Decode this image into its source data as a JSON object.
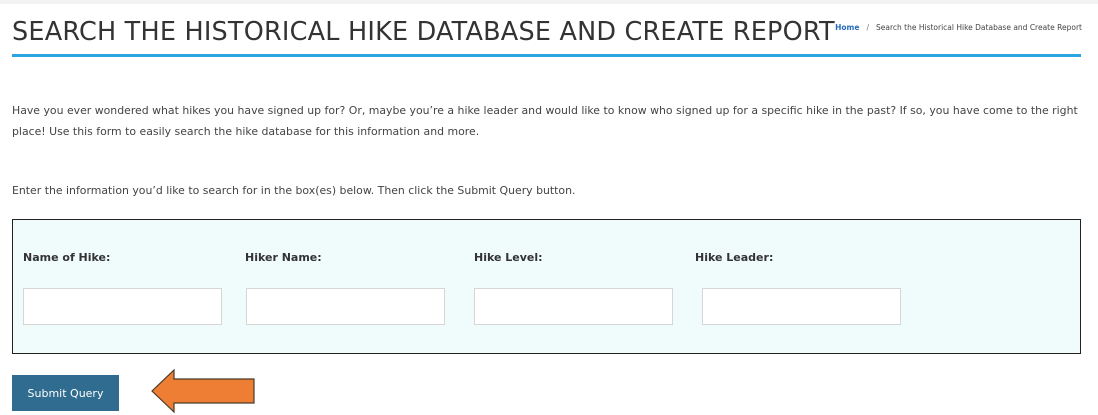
{
  "page": {
    "title": "SEARCH THE HISTORICAL HIKE DATABASE AND CREATE REPORT"
  },
  "breadcrumb": {
    "home": "Home",
    "separator": "/",
    "current": "Search the Historical Hike Database and Create Report"
  },
  "intro": {
    "text": "Have you ever wondered what hikes you have signed up for?  Or, maybe you’re a hike leader and would like to know who signed up for a specific hike in the past?  If so, you have come to the right place!   Use this form to easily search the hike database for this information and more."
  },
  "instruction": {
    "text": "Enter the information you’d like to search for in the box(es) below. Then click the Submit Query button."
  },
  "form": {
    "fields": [
      {
        "label": "Name of Hike:",
        "value": "",
        "placeholder": ""
      },
      {
        "label": "Hiker Name:",
        "value": "",
        "placeholder": ""
      },
      {
        "label": "Hike Level:",
        "value": "",
        "placeholder": ""
      },
      {
        "label": "Hike Leader:",
        "value": "",
        "placeholder": ""
      }
    ],
    "submit_label": "Submit Query"
  },
  "annotation": {
    "icon": "left-arrow-icon",
    "color": "#ee7e33",
    "outline_color": "#4a3a2a"
  },
  "colors": {
    "accent_rule": "#29a6df",
    "panel_background": "#f0fbfc",
    "button_background": "#2f6c8f",
    "link": "#2a6ebb"
  }
}
